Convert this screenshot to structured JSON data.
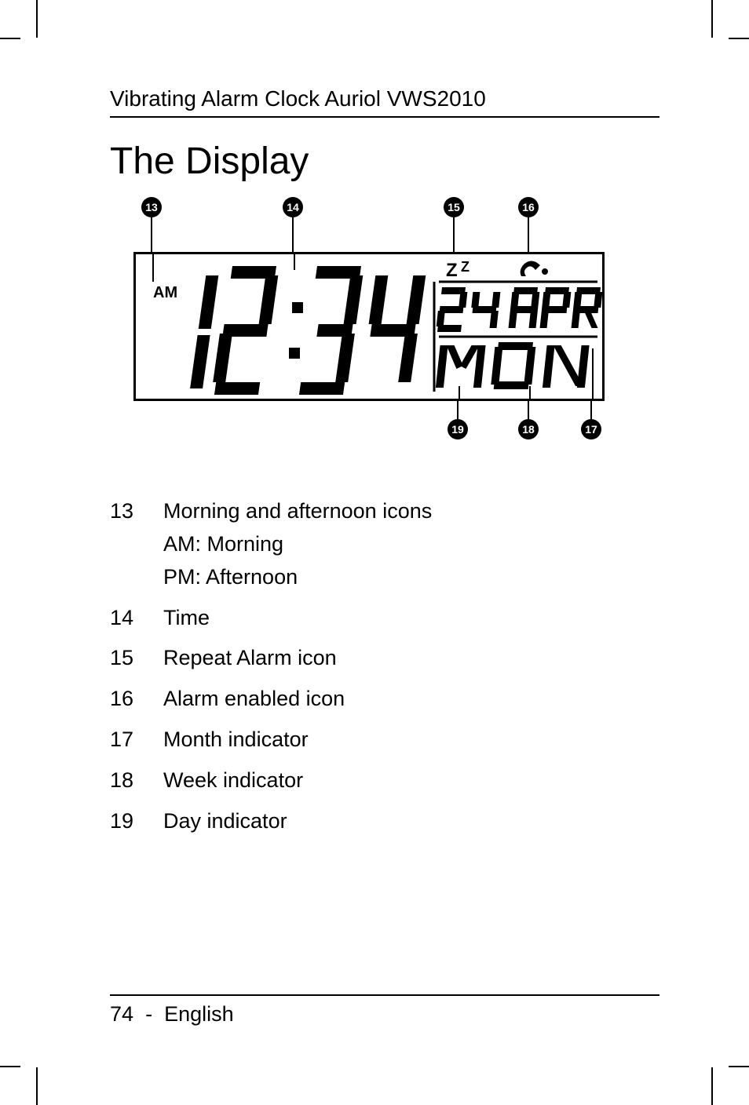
{
  "header": {
    "running_head": "Vibrating Alarm Clock Auriol VWS2010"
  },
  "title": "The Display",
  "display": {
    "am_label": "AM",
    "time": "12:34",
    "snooze_icon_text": "Z",
    "date_day": "24",
    "date_month": "APR",
    "weekday": "MON"
  },
  "callouts": {
    "c13": "13",
    "c14": "14",
    "c15": "15",
    "c16": "16",
    "c17": "17",
    "c18": "18",
    "c19": "19"
  },
  "legend": [
    {
      "num": "13",
      "desc": "Morning and afternoon icons",
      "subs": [
        "AM: Morning",
        "PM: Afternoon"
      ]
    },
    {
      "num": "14",
      "desc": "Time"
    },
    {
      "num": "15",
      "desc": "Repeat Alarm icon"
    },
    {
      "num": "16",
      "desc": "Alarm enabled icon"
    },
    {
      "num": "17",
      "desc": "Month indicator"
    },
    {
      "num": "18",
      "desc": "Week indicator"
    },
    {
      "num": "19",
      "desc": "Day indicator"
    }
  ],
  "footer": {
    "page": "74",
    "sep": "-",
    "lang": "English"
  }
}
